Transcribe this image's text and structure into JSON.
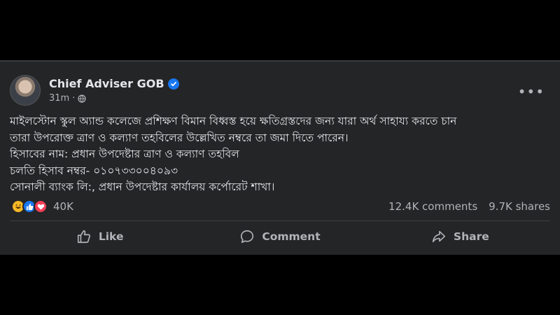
{
  "post": {
    "author": "Chief Adviser GOB",
    "time": "31m",
    "separator": "·",
    "more": "•••",
    "body_lines": [
      "মাইলস্টোন স্কুল অ্যান্ড কলেজে প্রশিক্ষণ বিমান বিধ্বস্ত হয়ে ক্ষতিগ্রস্তদের জন্য যারা অর্থ সাহায্য করতে চান",
      "তারা উপরোক্ত ত্রাণ ও কল্যাণ তহবিলের উল্লেখিত নম্বরে তা জমা দিতে পারেন।",
      "হিসাবের নাম: প্রধান উপদেষ্টার ত্রাণ ও কল্যাণ তহবিল",
      "চলতি হিসাব নম্বর- ০১০৭৩৩০০৪০৯৩",
      "সোনালী ব্যাংক লি:, প্রধান উপদেষ্টার কার্যালয় কর্পোরেট শাখা।"
    ],
    "reaction_count": "40K",
    "comments": "12.4K comments",
    "shares": "9.7K shares",
    "reactions": [
      "haha",
      "like",
      "love"
    ]
  },
  "actions": {
    "like": "Like",
    "comment": "Comment",
    "share": "Share"
  },
  "colors": {
    "card": "#242526",
    "text": "#e4e6eb",
    "muted": "#b0b3b8",
    "verified": "#1877f2"
  }
}
